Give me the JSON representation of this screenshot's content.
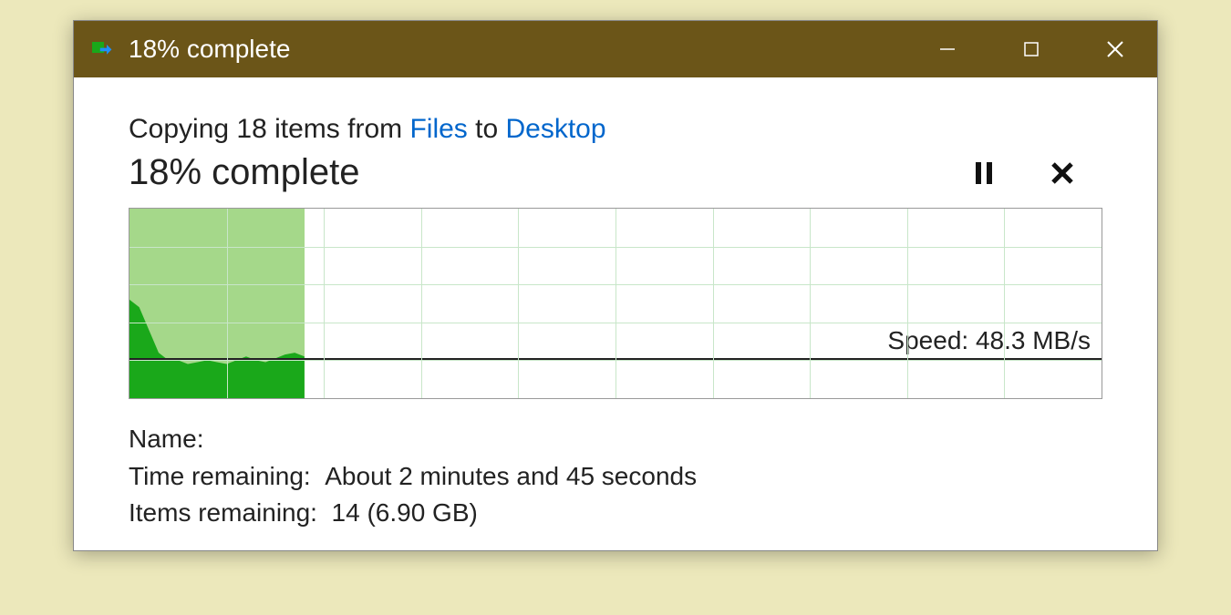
{
  "titlebar": {
    "title": "18% complete"
  },
  "main": {
    "copy_prefix": "Copying 18 items from ",
    "source_link": "Files",
    "to_text": " to ",
    "dest_link": "Desktop",
    "progress_text": "18% complete",
    "speed_label": "Speed: 48.3 MB/s"
  },
  "details": {
    "name_label": "Name:",
    "name_value": "",
    "time_label": "Time remaining:  ",
    "time_value": "About 2 minutes and 45 seconds",
    "items_label": "Items remaining:  ",
    "items_value": "14 (6.90 GB)"
  },
  "chart_data": {
    "type": "area",
    "progress_percent": 18,
    "speed_line_percent_from_top": 79,
    "grid_cols": 10,
    "grid_rows": 5,
    "xlabel": "",
    "ylabel": "",
    "title": "",
    "series": [
      {
        "name": "transfer-speed",
        "x_percent": [
          0,
          1,
          2,
          3,
          4,
          5,
          6,
          7,
          8,
          9,
          10,
          11,
          12,
          13,
          14,
          15,
          16,
          17,
          18
        ],
        "y_percent_height": [
          52,
          48,
          36,
          24,
          20,
          20,
          18,
          19,
          20,
          19,
          18,
          20,
          22,
          20,
          19,
          21,
          23,
          24,
          22
        ]
      }
    ]
  }
}
